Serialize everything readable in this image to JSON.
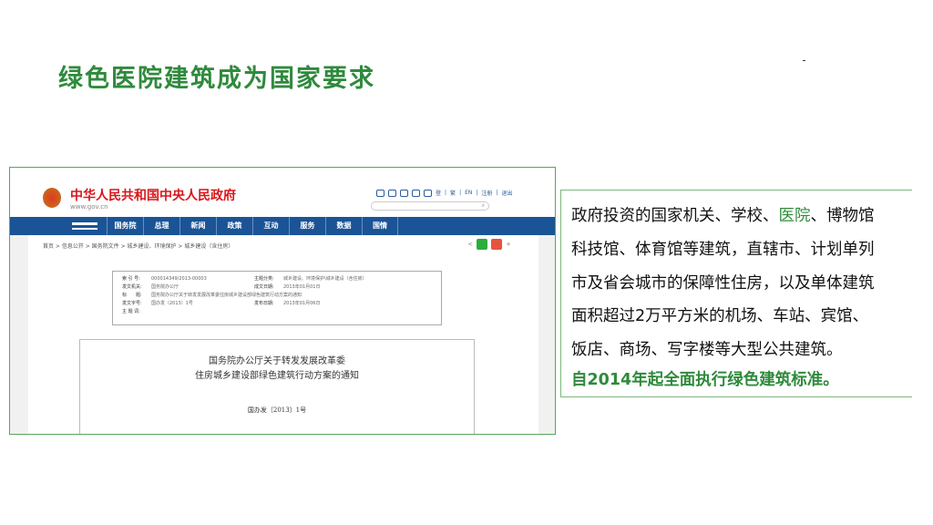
{
  "title": "绿色医院建筑成为国家要求",
  "site": {
    "name": "中华人民共和国中央人民政府",
    "url": "www.gov.cn",
    "tools": [
      "登",
      "繁",
      "EN",
      "注册",
      "退出"
    ],
    "nav": [
      "国务院",
      "总理",
      "新闻",
      "政策",
      "互动",
      "服务",
      "数据",
      "国情"
    ],
    "breadcrumb": "首页 > 信息公开 > 国务院文件 > 城乡建设、环境保护 > 城乡建设（含住房）",
    "share_plus": "+",
    "meta": [
      {
        "k1": "索 引 号:",
        "v1": "000014349/2013-00003",
        "k2": "主题分类:",
        "v2": "城乡建设、环境保护\\城乡建设（含住房）"
      },
      {
        "k1": "发文机关:",
        "v1": "国务院办公厅",
        "k2": "成文日期:",
        "v2": "2013年01月01日"
      },
      {
        "k1": "标　　题:",
        "v1": "国务院办公厅关于转发发展改革委住房城乡建设部绿色建筑行动方案的通知",
        "k2": "",
        "v2": ""
      },
      {
        "k1": "发文字号:",
        "v1": "国办发〔2013〕1号",
        "k2": "发布日期:",
        "v2": "2013年01月06日"
      },
      {
        "k1": "主 题 词:",
        "v1": "",
        "k2": "",
        "v2": ""
      }
    ],
    "doc": {
      "line1": "国务院办公厅关于转发发展改革委",
      "line2": "住房城乡建设部绿色建筑行动方案的通知",
      "number": "国办发〔2013〕1号"
    }
  },
  "text": {
    "l1a": "政府投资的国家机关、学校、",
    "l1b": "医院",
    "l1c": "、博物馆",
    "l2": "科技馆、体育馆等建筑，直辖市、计划单列",
    "l3": "市及省会城市的保障性住房，以及单体建筑",
    "l4": "面积超过2万平方米的机场、车站、宾馆、",
    "l5": "饭店、商场、写字楼等大型公共建筑。",
    "l6": "自2014年起全面执行绿色建筑标准。"
  },
  "colors": {
    "accent": "#2f8a3c",
    "nav": "#1a5496",
    "site_red": "#d8161b"
  }
}
